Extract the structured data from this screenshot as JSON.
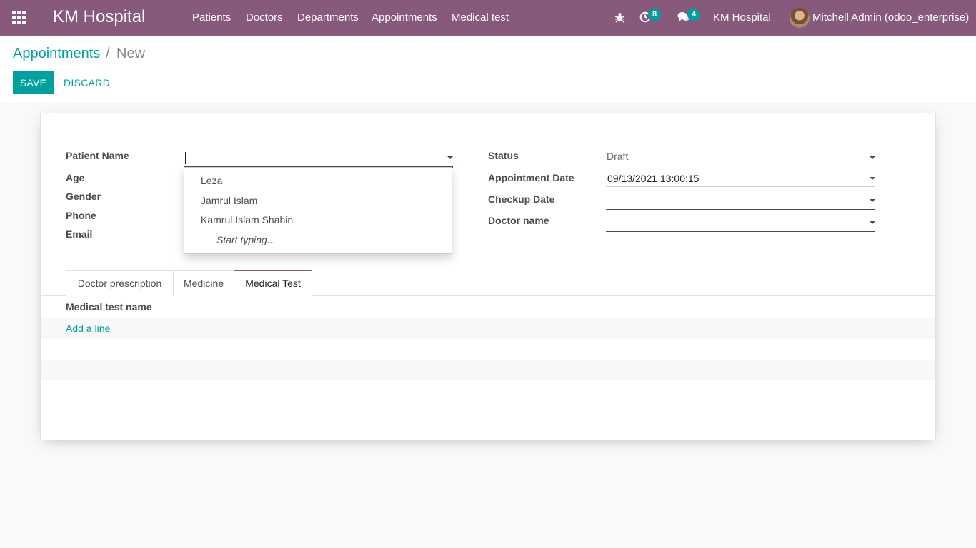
{
  "navbar": {
    "apps_icon": "apps-grid-icon",
    "brand": "KM Hospital",
    "menu": [
      "Patients",
      "Doctors",
      "Departments",
      "Appointments",
      "Medical test"
    ],
    "debug_icon": "bug-icon",
    "activity_icon": "clock-icon",
    "activity_count": "8",
    "messages_icon": "chat-icon",
    "messages_count": "4",
    "company": "KM Hospital",
    "user": "Mitchell Admin (odoo_enterprise)"
  },
  "breadcrumb": {
    "parent": "Appointments",
    "separator": "/",
    "current": "New"
  },
  "buttons": {
    "save": "SAVE",
    "discard": "DISCARD"
  },
  "form": {
    "left_labels": {
      "patient_name": "Patient Name",
      "age": "Age",
      "gender": "Gender",
      "phone": "Phone",
      "email": "Email"
    },
    "patient_name_value": "",
    "right_labels": {
      "status": "Status",
      "appointment_date": "Appointment Date",
      "checkup_date": "Checkup Date",
      "doctor_name": "Doctor name"
    },
    "status_value": "Draft",
    "appointment_date_value": "09/13/2021 13:00:15",
    "checkup_date_value": "",
    "doctor_name_value": ""
  },
  "dropdown": {
    "options": [
      "Leza",
      "Jamrul Islam",
      "Kamrul Islam Shahin"
    ],
    "hint": "Start typing..."
  },
  "tabs": [
    "Doctor prescription",
    "Medicine",
    "Medical Test"
  ],
  "active_tab": "Medical Test",
  "list": {
    "column": "Medical test name",
    "add_line": "Add a line"
  },
  "colors": {
    "navbar": "#875a7b",
    "accent": "#00a09d",
    "badge": "#00a09d"
  }
}
